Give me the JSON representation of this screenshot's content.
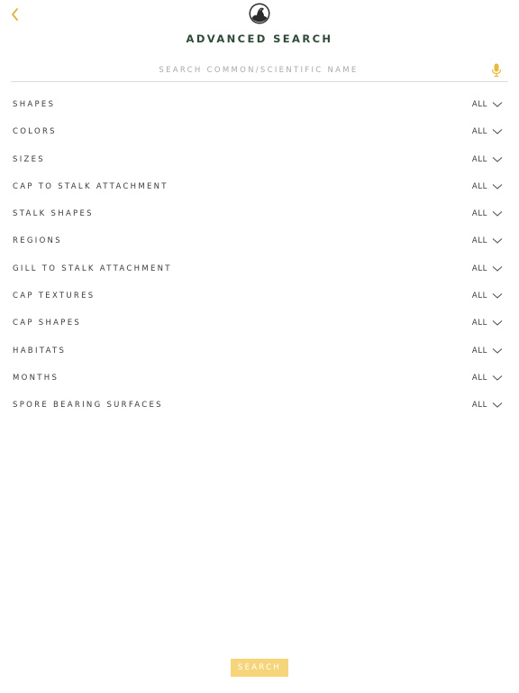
{
  "header": {
    "title": "ADVANCED SEARCH",
    "back_icon": "chevron-left-icon",
    "logo_icon": "mushroom-silhouette-logo"
  },
  "search": {
    "placeholder": "SEARCH COMMON/SCIENTIFIC NAME",
    "value": "",
    "mic_icon": "microphone-icon"
  },
  "filters": [
    {
      "label": "SHAPES",
      "value": "ALL"
    },
    {
      "label": "COLORS",
      "value": "ALL"
    },
    {
      "label": "SIZES",
      "value": "ALL"
    },
    {
      "label": "CAP TO STALK ATTACHMENT",
      "value": "ALL"
    },
    {
      "label": "STALK SHAPES",
      "value": "ALL"
    },
    {
      "label": "REGIONS",
      "value": "ALL"
    },
    {
      "label": "GILL TO STALK ATTACHMENT",
      "value": "ALL"
    },
    {
      "label": "CAP TEXTURES",
      "value": "ALL"
    },
    {
      "label": "CAP SHAPES",
      "value": "ALL"
    },
    {
      "label": "HABITATS",
      "value": "ALL"
    },
    {
      "label": "MONTHS",
      "value": "ALL"
    },
    {
      "label": "SPORE BEARING SURFACES",
      "value": "ALL"
    }
  ],
  "footer": {
    "search_label": "SEARCH"
  },
  "colors": {
    "accent": "#f6d47a",
    "back_arrow": "#e0b33c",
    "mic": "#e8b93a",
    "title": "#2f4a38",
    "text": "#3a3a3a",
    "placeholder": "#a9a9a9",
    "divider": "#dcdcdc"
  }
}
